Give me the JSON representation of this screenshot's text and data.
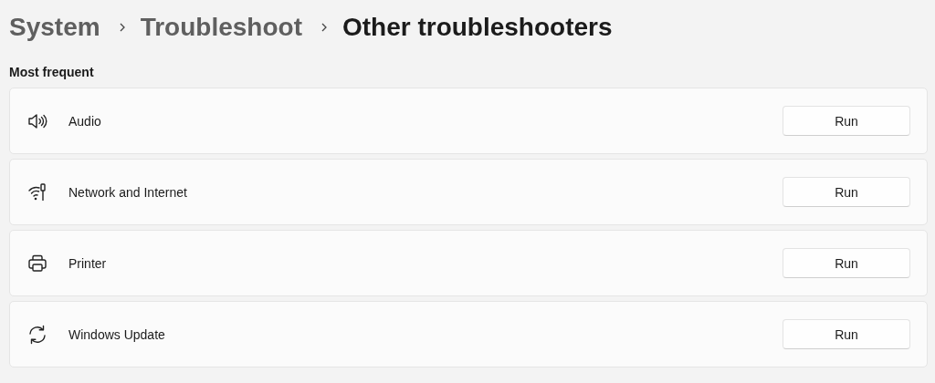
{
  "breadcrumb": [
    {
      "label": "System",
      "current": false
    },
    {
      "label": "Troubleshoot",
      "current": false
    },
    {
      "label": "Other troubleshooters",
      "current": true
    }
  ],
  "section": {
    "title": "Most frequent"
  },
  "troubleshooters": [
    {
      "name": "Audio",
      "button": "Run"
    },
    {
      "name": "Network and Internet",
      "button": "Run"
    },
    {
      "name": "Printer",
      "button": "Run"
    },
    {
      "name": "Windows Update",
      "button": "Run"
    }
  ]
}
